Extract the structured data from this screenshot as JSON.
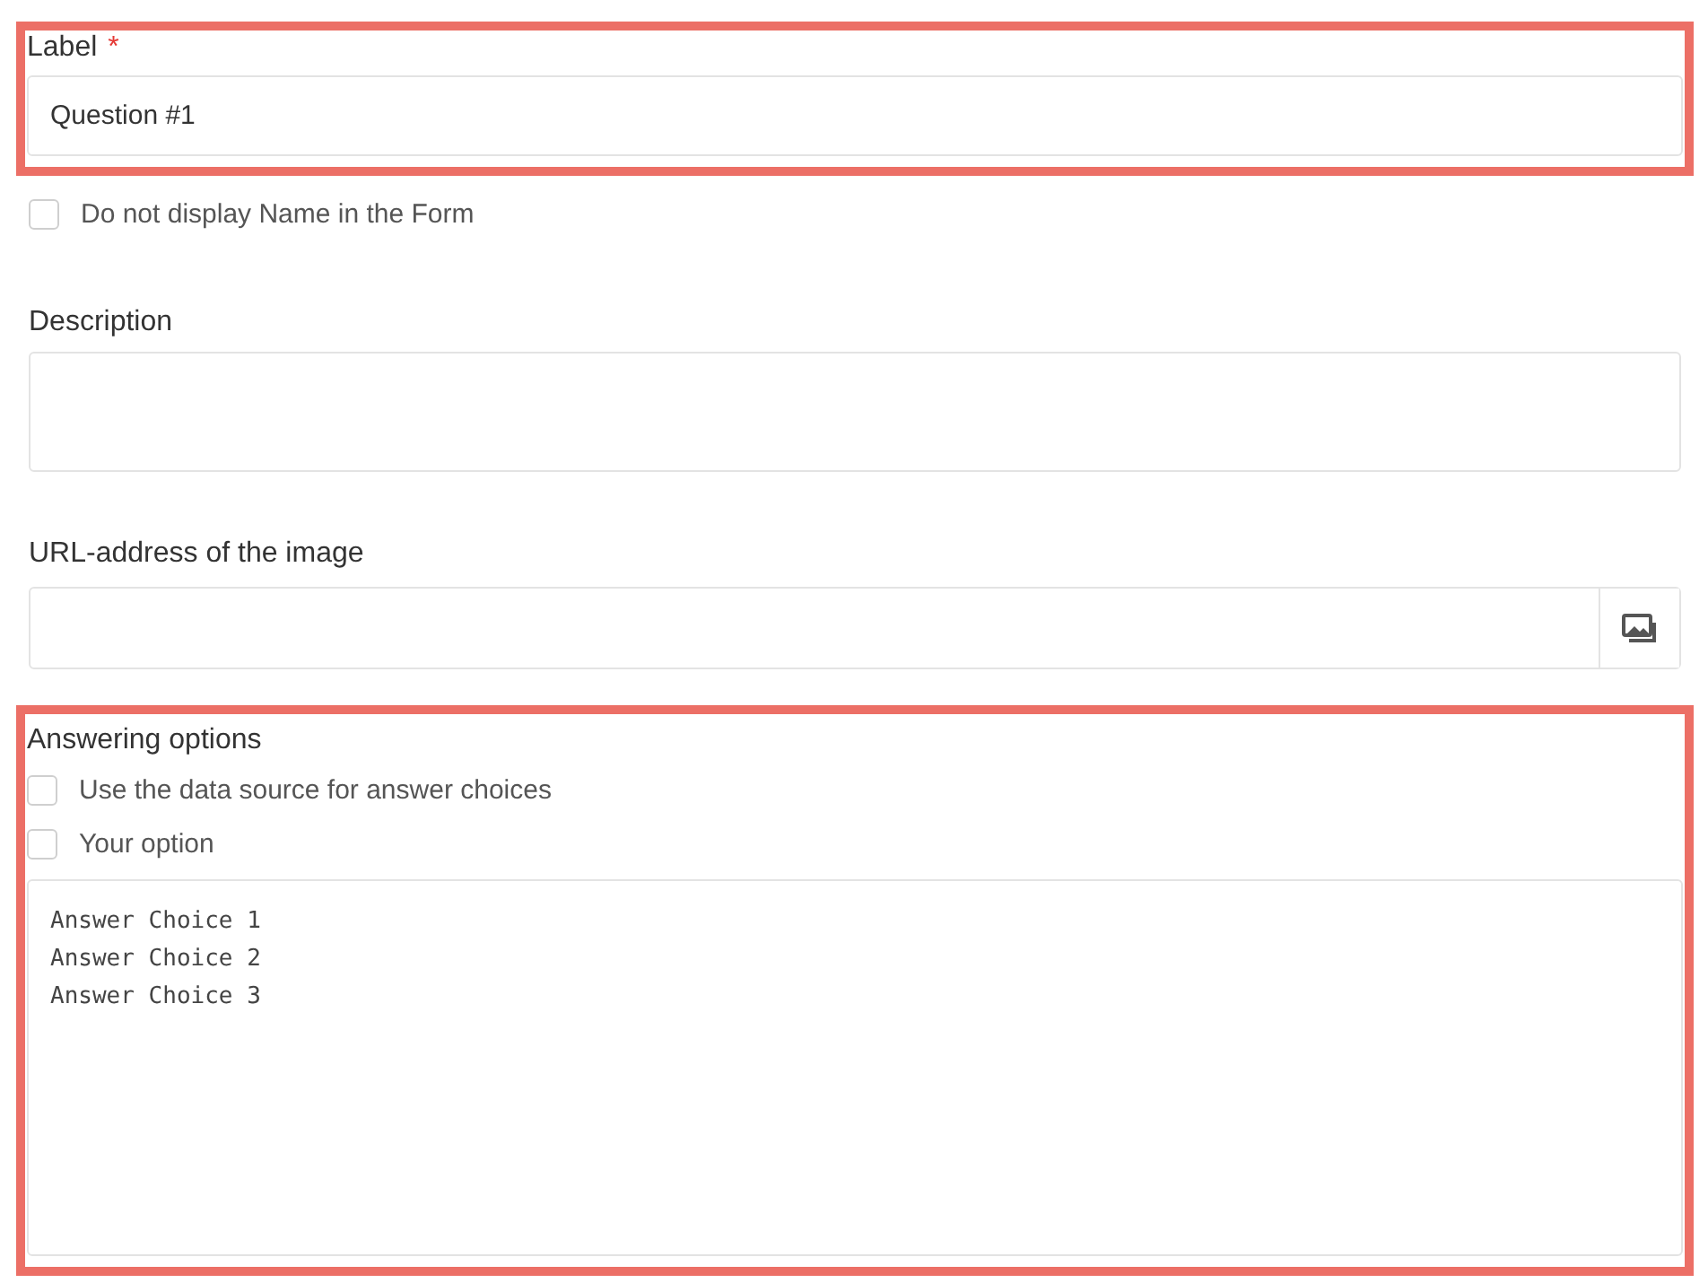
{
  "label_section": {
    "highlighted": true,
    "label": "Label",
    "required_mark": "*",
    "value": "Question #1"
  },
  "hide_name": {
    "label": "Do not display Name in the Form",
    "checked": false
  },
  "description": {
    "label": "Description"
  },
  "image_url": {
    "label": "URL-address of the image"
  },
  "answer_section": {
    "highlighted": true,
    "label": "Answering options",
    "options": [
      {
        "label": "Use the data source for answer choices",
        "checked": false
      },
      {
        "label": "Your option",
        "checked": false
      }
    ],
    "choices": [
      "Answer Choice 1",
      "Answer Choice 2",
      "Answer Choice 3"
    ]
  }
}
